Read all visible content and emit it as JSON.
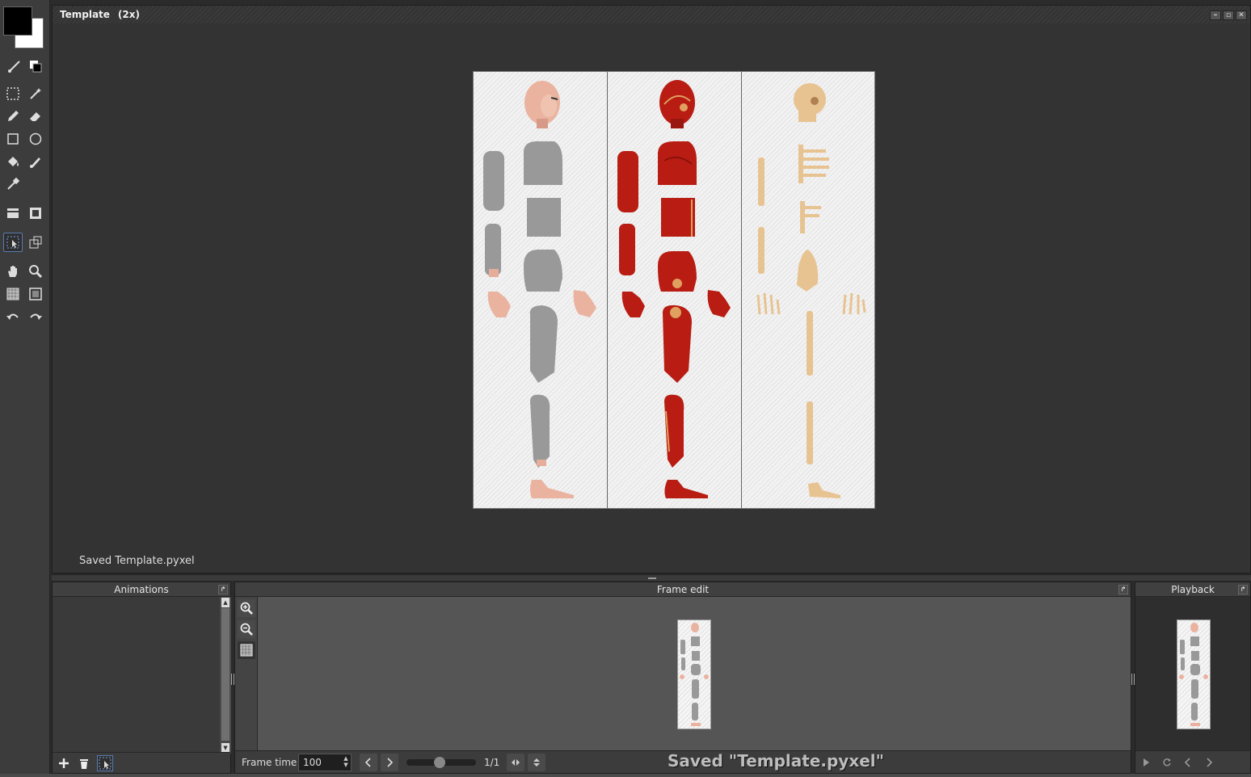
{
  "canvas_window": {
    "title": "Template",
    "zoom": "(2x)",
    "status": "Saved Template.pyxel",
    "window_buttons": [
      "–",
      "▫",
      "✕"
    ]
  },
  "colors": {
    "primary": "#000000",
    "secondary": "#ffffff"
  },
  "tools": [
    "line-tool",
    "swap-colors",
    "select-rect",
    "magic-wand",
    "pencil",
    "eraser",
    "rectangle",
    "ellipse",
    "fill-bucket",
    "brush",
    "color-picker",
    "tile-mode-1",
    "tile-mode-2",
    "select-cursor",
    "transform",
    "hand",
    "zoom",
    "grid-toggle",
    "frame-toggle",
    "undo",
    "redo"
  ],
  "panels": {
    "animations": {
      "title": "Animations"
    },
    "frame_edit": {
      "title": "Frame edit",
      "frame_time_label": "Frame time",
      "frame_time_value": "100",
      "frame_counter": "1/1",
      "saved_overlay": "Saved \"Template.pyxel\""
    },
    "playback": {
      "title": "Playback"
    }
  },
  "sprite_sheet": {
    "columns": [
      "skin",
      "muscle",
      "skeleton"
    ]
  }
}
